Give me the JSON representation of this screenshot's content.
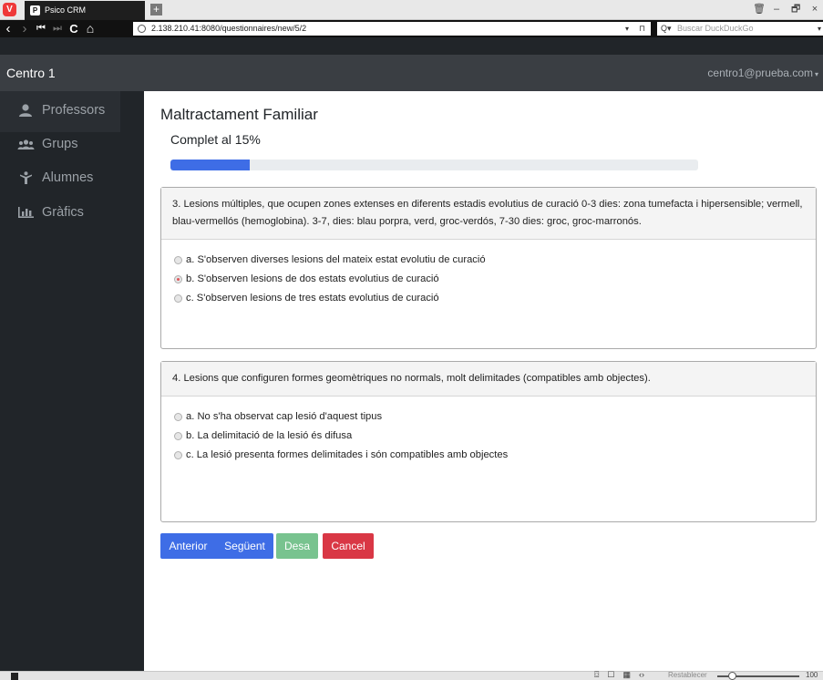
{
  "browser": {
    "tab_title": "Psico CRM",
    "tab_favicon": "P",
    "logo_letter": "V",
    "new_tab_symbol": "+",
    "url": "2.138.210.41:8080/questionnaires/new/5/2",
    "search_placeholder": "Buscar DuckDuckGo",
    "nav": {
      "back": "‹",
      "forward": "›",
      "rewind": "⏮",
      "fastforward": "⏭",
      "reload": "C",
      "home": "⌂"
    },
    "window_controls": {
      "trash": "🗑",
      "minimize": "–",
      "restore": "🗗",
      "close": "×"
    },
    "url_caret": "▾",
    "bookmark": "⊓",
    "search_icon": "Q▾",
    "search_caret": "▾"
  },
  "app": {
    "brand": "Centro 1",
    "user_email": "centro1@prueba.com",
    "user_caret": "▾"
  },
  "sidebar": {
    "items": [
      {
        "label": "Professors",
        "icon": "user-icon"
      },
      {
        "label": "Grups",
        "icon": "users-icon"
      },
      {
        "label": "Alumnes",
        "icon": "child-icon"
      },
      {
        "label": "Gràfics",
        "icon": "bar-chart-icon"
      }
    ]
  },
  "main": {
    "title": "Maltractament Familiar",
    "progress_label": "Complet al 15%",
    "progress_fraction": 0.15
  },
  "questions": [
    {
      "text": "3. Lesions múltiples, que ocupen zones extenses en diferents estadis evolutius de curació 0-3 dies: zona tumefacta i hipersensible; vermell, blau-vermellós (hemoglobina). 3-7, dies: blau porpra, verd, groc-verdós, 7-30 dies: groc, groc-marronós.",
      "options": [
        {
          "label": "a. S'observen diverses lesions del mateix estat evolutiu de curació",
          "checked": false
        },
        {
          "label": "b. S'observen lesions de dos estats evolutius de curació",
          "checked": true
        },
        {
          "label": "c. S'observen lesions de tres estats evolutius de curació",
          "checked": false
        }
      ]
    },
    {
      "text": "4. Lesions que configuren formes geomètriques no normals, molt delimitades (compatibles amb objectes).",
      "options": [
        {
          "label": "a. No s'ha observat cap lesió d'aquest tipus",
          "checked": false
        },
        {
          "label": "b. La delimitació de la lesió és difusa",
          "checked": false
        },
        {
          "label": "c. La lesió presenta formes delimitades i són compatibles amb objectes",
          "checked": false
        }
      ]
    }
  ],
  "buttons": {
    "previous": "Anterior",
    "next": "Següent",
    "save": "Desa",
    "cancel": "Cancel"
  },
  "colors": {
    "primary": "#3e6de6",
    "success": "#78c38f",
    "danger": "#d93745",
    "sidebar_bg": "#212529",
    "navbar_bg": "#3a3e43"
  },
  "statusbar": {
    "reset_label": "Restablecer",
    "zoom_value": "100",
    "zoom_fraction": 0.15,
    "icons": {
      "capture": "⌼",
      "tile": "☐",
      "images": "▦",
      "code": "‹›"
    }
  }
}
